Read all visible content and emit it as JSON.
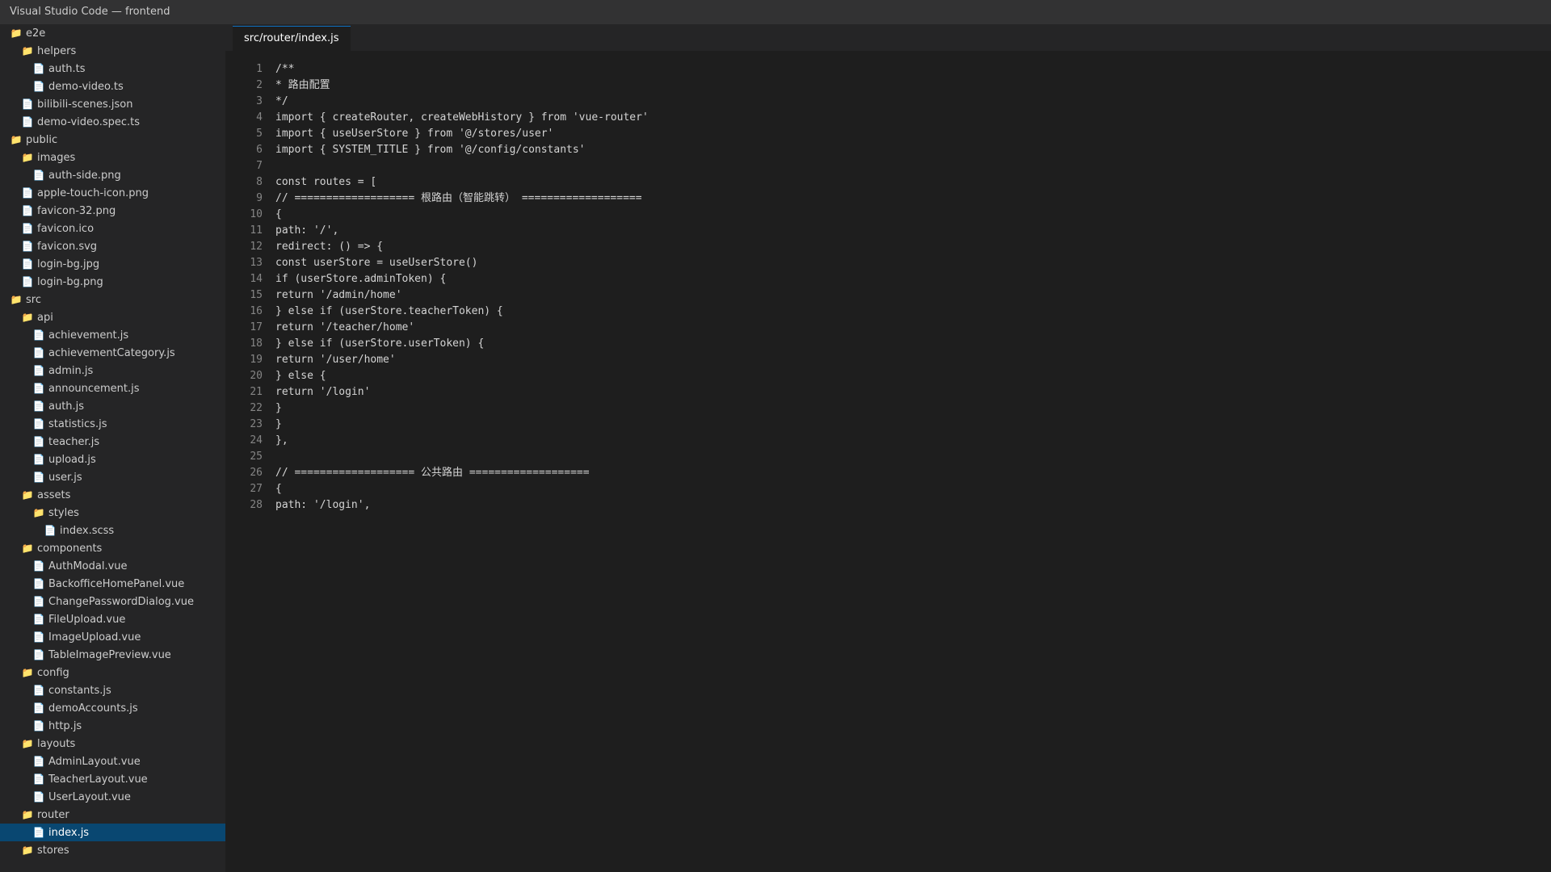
{
  "window": {
    "title": "Visual Studio Code — frontend"
  },
  "explorer": {
    "items": [
      {
        "label": "e2e",
        "type": "folder",
        "depth": 0,
        "selected": false
      },
      {
        "label": "helpers",
        "type": "folder",
        "depth": 1,
        "selected": false
      },
      {
        "label": "auth.ts",
        "type": "file",
        "depth": 2,
        "selected": false
      },
      {
        "label": "demo-video.ts",
        "type": "file",
        "depth": 2,
        "selected": false
      },
      {
        "label": "bilibili-scenes.json",
        "type": "file",
        "depth": 1,
        "selected": false
      },
      {
        "label": "demo-video.spec.ts",
        "type": "file",
        "depth": 1,
        "selected": false
      },
      {
        "label": "public",
        "type": "folder",
        "depth": 0,
        "selected": false
      },
      {
        "label": "images",
        "type": "folder",
        "depth": 1,
        "selected": false
      },
      {
        "label": "auth-side.png",
        "type": "file",
        "depth": 2,
        "selected": false
      },
      {
        "label": "apple-touch-icon.png",
        "type": "file",
        "depth": 1,
        "selected": false
      },
      {
        "label": "favicon-32.png",
        "type": "file",
        "depth": 1,
        "selected": false
      },
      {
        "label": "favicon.ico",
        "type": "file",
        "depth": 1,
        "selected": false
      },
      {
        "label": "favicon.svg",
        "type": "file",
        "depth": 1,
        "selected": false
      },
      {
        "label": "login-bg.jpg",
        "type": "file",
        "depth": 1,
        "selected": false
      },
      {
        "label": "login-bg.png",
        "type": "file",
        "depth": 1,
        "selected": false
      },
      {
        "label": "src",
        "type": "folder",
        "depth": 0,
        "selected": false
      },
      {
        "label": "api",
        "type": "folder",
        "depth": 1,
        "selected": false
      },
      {
        "label": "achievement.js",
        "type": "file",
        "depth": 2,
        "selected": false
      },
      {
        "label": "achievementCategory.js",
        "type": "file",
        "depth": 2,
        "selected": false
      },
      {
        "label": "admin.js",
        "type": "file",
        "depth": 2,
        "selected": false
      },
      {
        "label": "announcement.js",
        "type": "file",
        "depth": 2,
        "selected": false
      },
      {
        "label": "auth.js",
        "type": "file",
        "depth": 2,
        "selected": false
      },
      {
        "label": "statistics.js",
        "type": "file",
        "depth": 2,
        "selected": false
      },
      {
        "label": "teacher.js",
        "type": "file",
        "depth": 2,
        "selected": false
      },
      {
        "label": "upload.js",
        "type": "file",
        "depth": 2,
        "selected": false
      },
      {
        "label": "user.js",
        "type": "file",
        "depth": 2,
        "selected": false
      },
      {
        "label": "assets",
        "type": "folder",
        "depth": 1,
        "selected": false
      },
      {
        "label": "styles",
        "type": "folder",
        "depth": 2,
        "selected": false
      },
      {
        "label": "index.scss",
        "type": "file",
        "depth": 3,
        "selected": false
      },
      {
        "label": "components",
        "type": "folder",
        "depth": 1,
        "selected": false
      },
      {
        "label": "AuthModal.vue",
        "type": "file",
        "depth": 2,
        "selected": false
      },
      {
        "label": "BackofficeHomePanel.vue",
        "type": "file",
        "depth": 2,
        "selected": false
      },
      {
        "label": "ChangePasswordDialog.vue",
        "type": "file",
        "depth": 2,
        "selected": false
      },
      {
        "label": "FileUpload.vue",
        "type": "file",
        "depth": 2,
        "selected": false
      },
      {
        "label": "ImageUpload.vue",
        "type": "file",
        "depth": 2,
        "selected": false
      },
      {
        "label": "TableImagePreview.vue",
        "type": "file",
        "depth": 2,
        "selected": false
      },
      {
        "label": "config",
        "type": "folder",
        "depth": 1,
        "selected": false
      },
      {
        "label": "constants.js",
        "type": "file",
        "depth": 2,
        "selected": false
      },
      {
        "label": "demoAccounts.js",
        "type": "file",
        "depth": 2,
        "selected": false
      },
      {
        "label": "http.js",
        "type": "file",
        "depth": 2,
        "selected": false
      },
      {
        "label": "layouts",
        "type": "folder",
        "depth": 1,
        "selected": false
      },
      {
        "label": "AdminLayout.vue",
        "type": "file",
        "depth": 2,
        "selected": false
      },
      {
        "label": "TeacherLayout.vue",
        "type": "file",
        "depth": 2,
        "selected": false
      },
      {
        "label": "UserLayout.vue",
        "type": "file",
        "depth": 2,
        "selected": false
      },
      {
        "label": "router",
        "type": "folder",
        "depth": 1,
        "selected": false
      },
      {
        "label": "index.js",
        "type": "file",
        "depth": 2,
        "selected": true
      },
      {
        "label": "stores",
        "type": "folder",
        "depth": 1,
        "selected": false
      }
    ]
  },
  "editor": {
    "tab_label": "src/router/index.js",
    "lines": [
      {
        "num": "1",
        "text": "/**"
      },
      {
        "num": "2",
        "text": "* 路由配置"
      },
      {
        "num": "3",
        "text": "*/"
      },
      {
        "num": "4",
        "text": "import { createRouter, createWebHistory } from 'vue-router'"
      },
      {
        "num": "5",
        "text": "import { useUserStore } from '@/stores/user'"
      },
      {
        "num": "6",
        "text": "import { SYSTEM_TITLE } from '@/config/constants'"
      },
      {
        "num": "7",
        "text": ""
      },
      {
        "num": "8",
        "text": "const routes = ["
      },
      {
        "num": "9",
        "text": "// =================== 根路由（智能跳转） ==================="
      },
      {
        "num": "10",
        "text": "{"
      },
      {
        "num": "11",
        "text": "path: '/',"
      },
      {
        "num": "12",
        "text": "redirect: () => {"
      },
      {
        "num": "13",
        "text": "const userStore = useUserStore()"
      },
      {
        "num": "14",
        "text": "if (userStore.adminToken) {"
      },
      {
        "num": "15",
        "text": "return '/admin/home'"
      },
      {
        "num": "16",
        "text": "} else if (userStore.teacherToken) {"
      },
      {
        "num": "17",
        "text": "return '/teacher/home'"
      },
      {
        "num": "18",
        "text": "} else if (userStore.userToken) {"
      },
      {
        "num": "19",
        "text": "return '/user/home'"
      },
      {
        "num": "20",
        "text": "} else {"
      },
      {
        "num": "21",
        "text": "return '/login'"
      },
      {
        "num": "22",
        "text": "}"
      },
      {
        "num": "23",
        "text": "}"
      },
      {
        "num": "24",
        "text": "},"
      },
      {
        "num": "25",
        "text": ""
      },
      {
        "num": "26",
        "text": "// =================== 公共路由 ==================="
      },
      {
        "num": "27",
        "text": "{"
      },
      {
        "num": "28",
        "text": "path: '/login',"
      }
    ]
  },
  "colors": {
    "titlebar_bg": "#323233",
    "sidebar_bg": "#252526",
    "editor_bg": "#1e1e1e",
    "selection_bg": "#094771",
    "folder_icon": "#dcb67a",
    "tab_accent": "#0e70c0"
  },
  "icons": {
    "folder": "folder-icon",
    "file": "file-icon"
  }
}
